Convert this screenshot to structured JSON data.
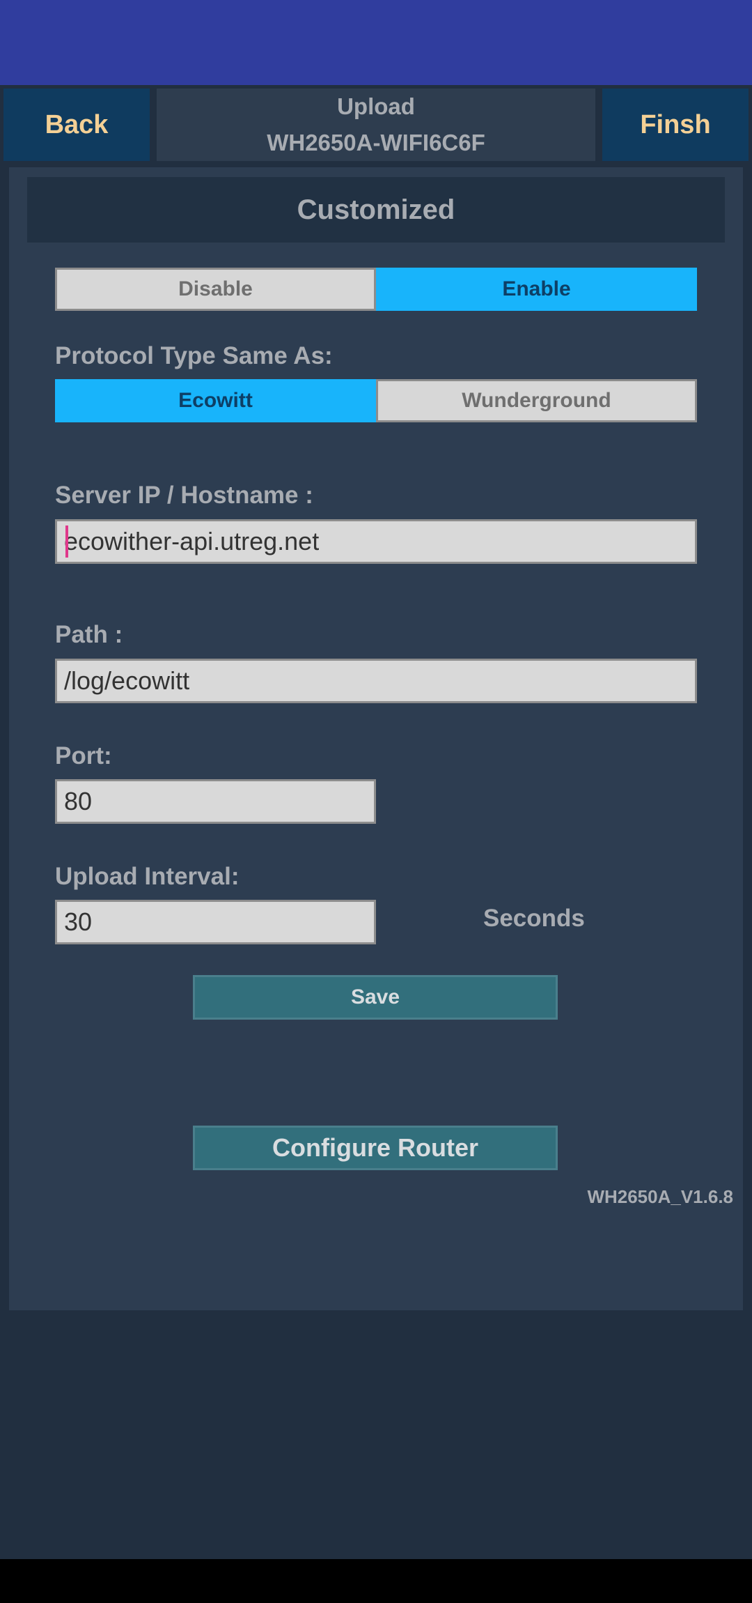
{
  "header": {
    "back_label": "Back",
    "title_line1": "Upload",
    "title_line2": "WH2650A-WIFI6C6F",
    "finish_label": "Finsh"
  },
  "section": {
    "title": "Customized"
  },
  "customized_toggle": {
    "disable_label": "Disable",
    "enable_label": "Enable",
    "selected": "Enable"
  },
  "protocol": {
    "label": "Protocol Type Same As:",
    "options": [
      "Ecowitt",
      "Wunderground"
    ],
    "selected": "Ecowitt"
  },
  "server": {
    "label": "Server IP / Hostname :",
    "value": "ecowither-api.utreg.net"
  },
  "path": {
    "label": "Path :",
    "value": "/log/ecowitt"
  },
  "port": {
    "label": "Port:",
    "value": "80"
  },
  "interval": {
    "label": "Upload Interval:",
    "value": "30",
    "unit": "Seconds"
  },
  "save_label": "Save",
  "configure_router_label": "Configure Router",
  "version": "WH2650A_V1.6.8",
  "colors": {
    "status_bar": "#303d9e",
    "accent": "#18b4fb",
    "button_teal": "#326f7c",
    "nav_button": "#0f3b5f",
    "nav_text": "#f4d095"
  }
}
